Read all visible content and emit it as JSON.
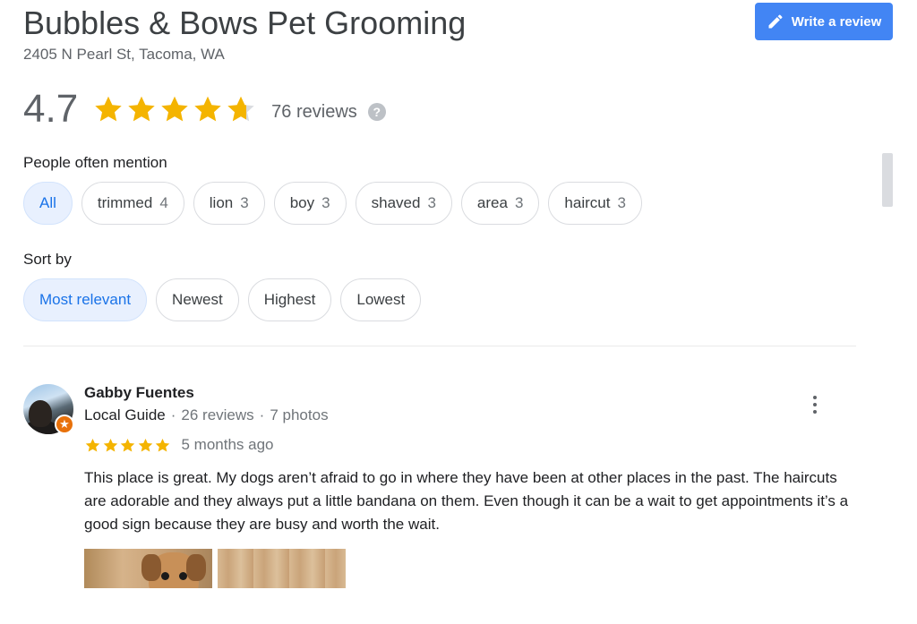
{
  "header": {
    "title": "Bubbles & Bows Pet Grooming",
    "address": "2405 N Pearl St, Tacoma, WA",
    "write_review_label": "Write a review"
  },
  "rating": {
    "value": "4.7",
    "stars": 4.7,
    "reviews_label": "76 reviews",
    "help_icon": "?"
  },
  "mentions": {
    "label": "People often mention",
    "chips": [
      {
        "label": "All",
        "count": "",
        "active": true
      },
      {
        "label": "trimmed",
        "count": "4"
      },
      {
        "label": "lion",
        "count": "3"
      },
      {
        "label": "boy",
        "count": "3"
      },
      {
        "label": "shaved",
        "count": "3"
      },
      {
        "label": "area",
        "count": "3"
      },
      {
        "label": "haircut",
        "count": "3"
      }
    ]
  },
  "sort": {
    "label": "Sort by",
    "options": [
      {
        "label": "Most relevant",
        "active": true
      },
      {
        "label": "Newest"
      },
      {
        "label": "Highest"
      },
      {
        "label": "Lowest"
      }
    ]
  },
  "review": {
    "name": "Gabby Fuentes",
    "guide": "Local Guide",
    "sep1": "·",
    "review_count": "26 reviews",
    "sep2": "·",
    "photo_count": "7 photos",
    "stars": 5,
    "time": "5 months ago",
    "text": "This place is great. My dogs aren’t afraid to go in where they have been at other places in the past. The haircuts are adorable and they always put a little bandana on them. Even though it can be a wait to get appointments it’s a good sign because they are busy and worth the wait."
  },
  "colors": {
    "star": "#f4b400",
    "star_empty": "#dadce0",
    "accent": "#4285f4",
    "chip_active_bg": "#e8f0fe",
    "chip_active_text": "#1a73e8",
    "guide_badge": "#e8710a"
  }
}
